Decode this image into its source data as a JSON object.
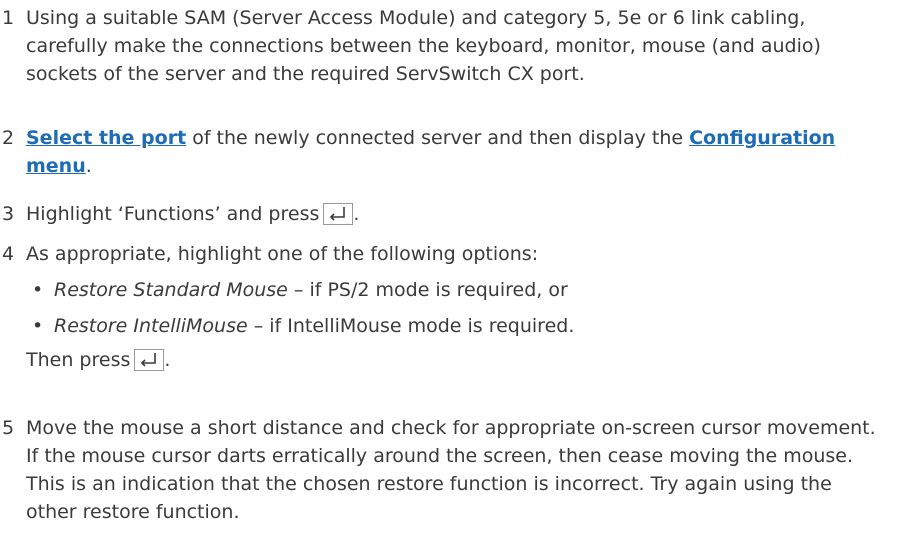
{
  "steps": [
    {
      "num": "1",
      "text": "Using a suitable SAM (Server Access Module) and category 5, 5e or 6 link cabling, carefully make the connections between the keyboard, monitor, mouse (and audio) sockets of the server and the required ServSwitch CX port."
    },
    {
      "num": "2",
      "link1": "Select the port",
      "mid": " of the newly connected server and then display the ",
      "link2": "Configuration menu",
      "end": "."
    },
    {
      "num": "3",
      "text": "Highlight ‘Functions’ and press",
      "end": "."
    },
    {
      "num": "4",
      "text": "As appropriate, highlight one of the following options:",
      "options": [
        {
          "bullet": "•",
          "name": "Restore Standard Mouse",
          "desc": " – if PS/2 mode is required, or"
        },
        {
          "bullet": "•",
          "name": "Restore IntelliMouse",
          "desc": " – if IntelliMouse mode is required."
        }
      ],
      "then": "Then press",
      "end": "."
    },
    {
      "num": "5",
      "text": "Move the mouse a short distance and check for appropriate on-screen cursor movement. If the mouse cursor darts erratically around the screen, then cease moving the mouse. This is an indication that the chosen restore function is incorrect. Try again using the other restore function."
    }
  ],
  "icons": {
    "enter_key": "enter-key-icon"
  },
  "colors": {
    "text": "#3a3a3a",
    "link": "#1e6cb6"
  }
}
